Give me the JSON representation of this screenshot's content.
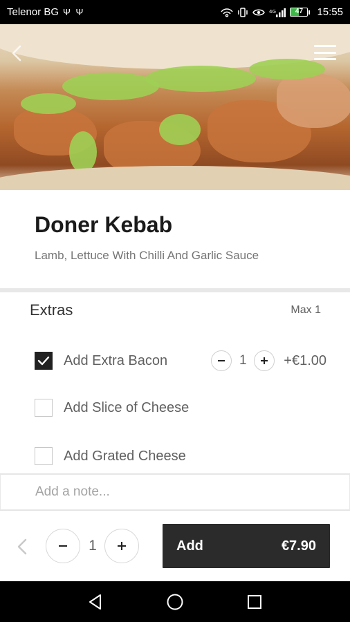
{
  "status_bar": {
    "carrier": "Telenor BG",
    "usb_icons": "Ψ Ψ",
    "battery_level": "47",
    "battery_fraction": 0.47,
    "time": "15:55"
  },
  "hero": {
    "image": "doner-kebab-photo"
  },
  "product": {
    "title": "Doner Kebab",
    "description": "Lamb, Lettuce With Chilli And Garlic Sauce"
  },
  "extras": {
    "title": "Extras",
    "max_label": "Max 1",
    "items": [
      {
        "label": "Add Extra Bacon",
        "checked": true,
        "quantity": "1",
        "price": "+€1.00"
      },
      {
        "label": "Add Slice of Cheese",
        "checked": false
      },
      {
        "label": "Add Grated Cheese",
        "checked": false
      }
    ]
  },
  "note": {
    "placeholder": "Add a note..."
  },
  "action_bar": {
    "quantity": "1",
    "add_label": "Add",
    "total_price": "€7.90"
  },
  "colors": {
    "primary_button": "#2b2b2b",
    "battery_green": "#3fb84a"
  }
}
